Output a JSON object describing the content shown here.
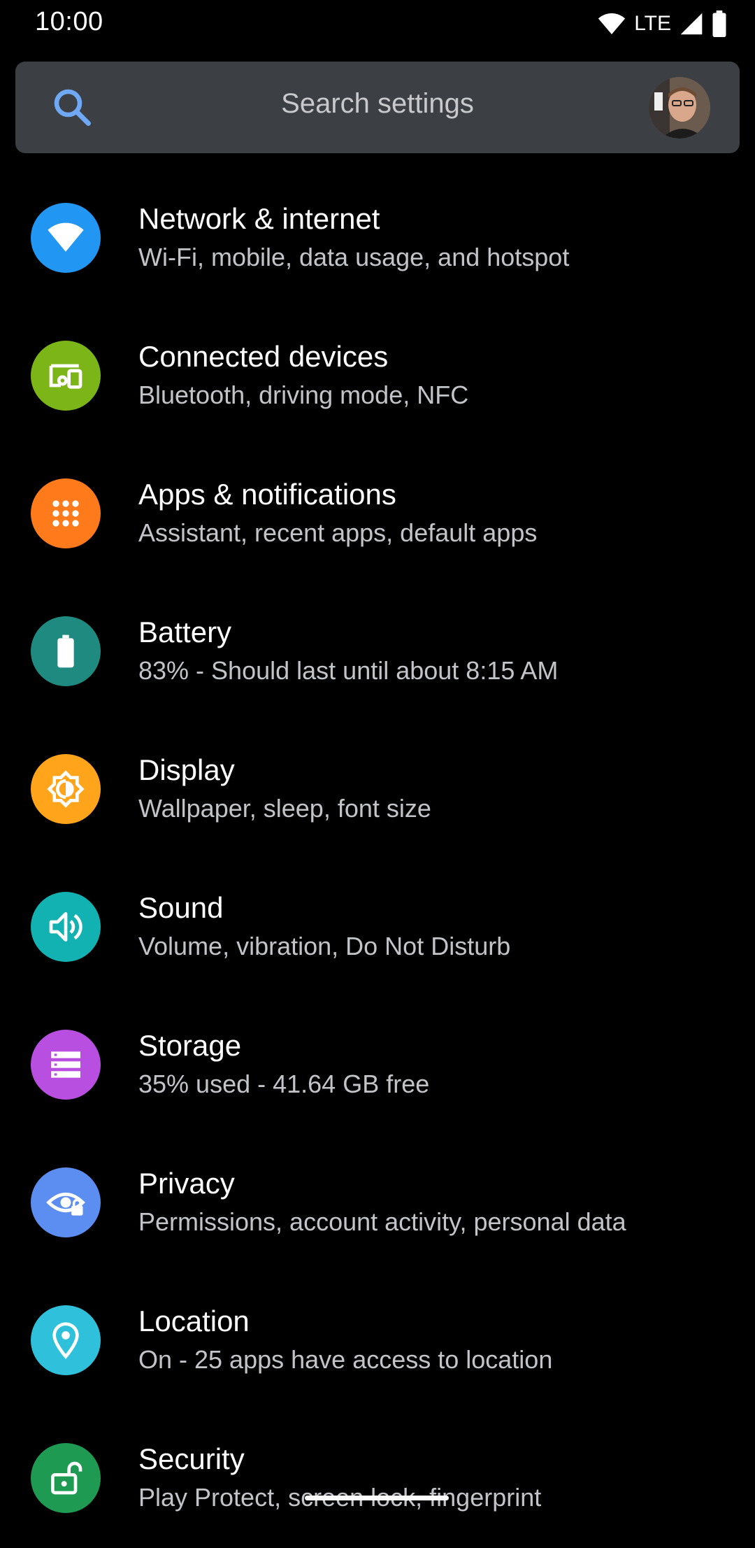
{
  "status_bar": {
    "time": "10:00",
    "network_type": "LTE"
  },
  "search": {
    "placeholder": "Search settings"
  },
  "settings_items": [
    {
      "title": "Network & internet",
      "subtitle": "Wi-Fi, mobile, data usage, and hotspot",
      "icon": "wifi-icon",
      "color": "#2196f3"
    },
    {
      "title": "Connected devices",
      "subtitle": "Bluetooth, driving mode, NFC",
      "icon": "devices-icon",
      "color": "#7cb518"
    },
    {
      "title": "Apps & notifications",
      "subtitle": "Assistant, recent apps, default apps",
      "icon": "apps-grid-icon",
      "color": "#ff7a1a"
    },
    {
      "title": "Battery",
      "subtitle": "83% - Should last until about 8:15 AM",
      "icon": "battery-icon",
      "color": "#1f8a80"
    },
    {
      "title": "Display",
      "subtitle": "Wallpaper, sleep, font size",
      "icon": "brightness-icon",
      "color": "#ffa41b"
    },
    {
      "title": "Sound",
      "subtitle": "Volume, vibration, Do Not Disturb",
      "icon": "volume-icon",
      "color": "#12b2b2"
    },
    {
      "title": "Storage",
      "subtitle": "35% used - 41.64 GB free",
      "icon": "storage-icon",
      "color": "#b94fe0"
    },
    {
      "title": "Privacy",
      "subtitle": "Permissions, account activity, personal data",
      "icon": "privacy-eye-icon",
      "color": "#5b8ef0"
    },
    {
      "title": "Location",
      "subtitle": "On - 25 apps have access to location",
      "icon": "location-pin-icon",
      "color": "#2fc1dc"
    },
    {
      "title": "Security",
      "subtitle": "Play Protect, screen lock, fingerprint",
      "icon": "lock-open-icon",
      "color": "#1e9a52"
    }
  ]
}
